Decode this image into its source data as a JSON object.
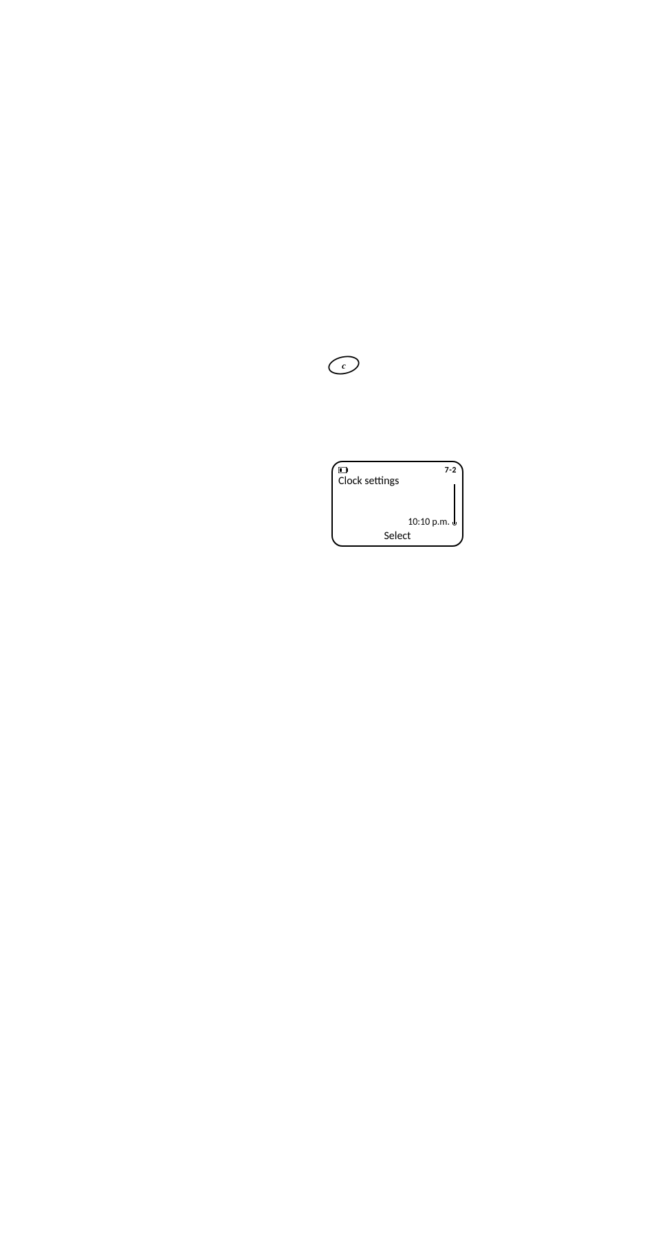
{
  "c_button": {
    "label": "c",
    "name": "c-key"
  },
  "screen": {
    "position": "7-2",
    "title": "Clock settings",
    "time": "10:10 p.m.",
    "softkey": "Select"
  }
}
